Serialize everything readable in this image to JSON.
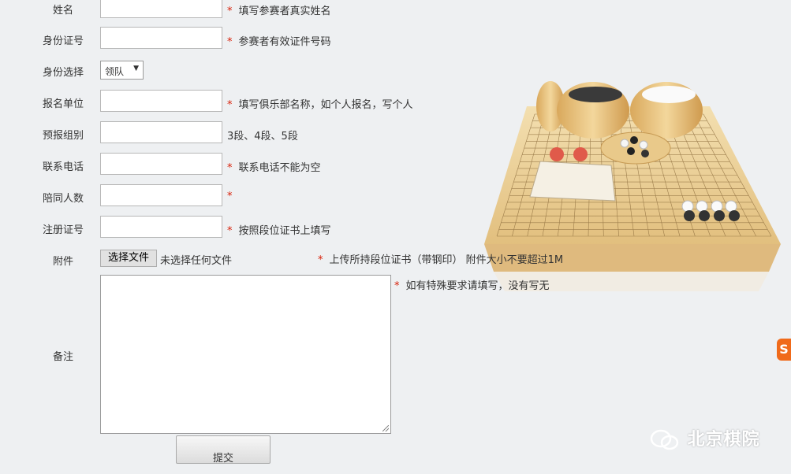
{
  "form": {
    "fields": [
      {
        "label": "姓名",
        "value": "",
        "hint": "填写参赛者真实姓名",
        "required": true
      },
      {
        "label": "身份证号",
        "value": "",
        "hint": "参赛者有效证件号码",
        "required": true
      },
      {
        "label": "身份选择",
        "selected": "领队"
      },
      {
        "label": "报名单位",
        "value": "",
        "hint": "填写俱乐部名称，如个人报名，写个人",
        "required": true
      },
      {
        "label": "预报组别",
        "value": "",
        "hint": "3段、4段、5段",
        "required": false
      },
      {
        "label": "联系电话",
        "value": "",
        "hint": "联系电话不能为空",
        "required": true
      },
      {
        "label": "陪同人数",
        "value": "",
        "hint": "",
        "required": true
      },
      {
        "label": "注册证号",
        "value": "",
        "hint": "按照段位证书上填写",
        "required": true
      }
    ],
    "attachment": {
      "label": "附件",
      "button_label": "选择文件",
      "status": "未选择任何文件",
      "hint": "上传所持段位证书（带钢印） 附件大小不要超过1M"
    },
    "remarks": {
      "label": "备注",
      "value": "",
      "hint": "如有特殊要求请填写，没有写无"
    },
    "submit_label": "提交",
    "required_mark": "*"
  },
  "watermark": {
    "text": "北京棋院"
  },
  "side_logo": {
    "text": "S"
  },
  "colors": {
    "required": "#d81e06",
    "background": "#eef0f2",
    "board_wood": "#e8c98c",
    "side_logo": "#f06a1a"
  }
}
